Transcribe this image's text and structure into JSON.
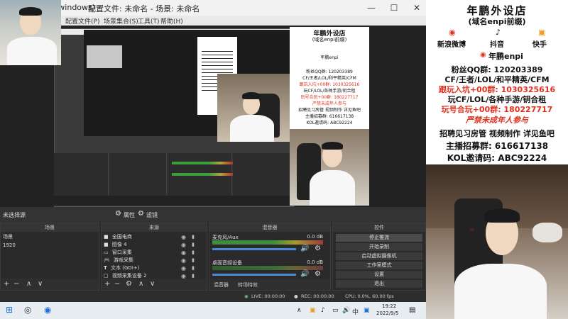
{
  "obs": {
    "window_title": "配置文件: 未命名 - 场景: 未命名",
    "title_prefix": "(windows)",
    "menu": [
      "配置文件(P)",
      "场景集合(S)",
      "工具(T)",
      "帮助(H)"
    ],
    "no_source_selected": "未选择源",
    "properties_label": "属性",
    "filters_label": "滤镜",
    "docks": {
      "scenes": {
        "title": "场景",
        "items": [
          "场景",
          "1920"
        ]
      },
      "sources": {
        "title": "来源",
        "items": [
          {
            "label": "全国电商",
            "icon": "■"
          },
          {
            "label": "图像 4",
            "icon": "■"
          },
          {
            "label": "窗口采集",
            "icon": "▭"
          },
          {
            "label": "游戏采集",
            "icon": "🎮"
          },
          {
            "label": "文本 (GDI+)",
            "icon": "T"
          },
          {
            "label": "视频采集设备 2",
            "icon": "▢"
          }
        ]
      },
      "mixer": {
        "title": "混音器",
        "channels": [
          {
            "name": "麦克风/Aux",
            "db": "0.0 dB"
          },
          {
            "name": "桌面音频设备",
            "db": "0.0 dB"
          }
        ],
        "tabs": [
          "混音器",
          "转场特效"
        ]
      },
      "controls": {
        "title": "控件",
        "buttons": [
          "停止推流",
          "开始录制",
          "启动虚拟摄像机",
          "工作室模式",
          "设置",
          "退出"
        ]
      }
    },
    "status": {
      "live": "LIVE: 00:00:00",
      "rec": "REC: 00:00:00",
      "cpu": "CPU: 0.0%, 60.00 fps"
    }
  },
  "taskbar": {
    "time": "19:22",
    "date": "2022/9/5",
    "ime": "中"
  },
  "ad_panel": {
    "title": "年鹏外设店",
    "subtitle": "(域名enpi前缀)",
    "socials": [
      {
        "name": "新浪微博",
        "icon": "weibo-icon",
        "glyph": "◉"
      },
      {
        "name": "抖音",
        "icon": "tiktok-icon",
        "glyph": "♪"
      },
      {
        "name": "快手",
        "icon": "kuaishou-icon",
        "glyph": "▣"
      }
    ],
    "brand": "年鹏enpi",
    "lines": [
      {
        "text": "粉丝QQ群: 120203389",
        "color": "#111111"
      },
      {
        "text": "CF/王者/LOL/和平精英/CFM",
        "color": "#111111"
      },
      {
        "text": "跟玩入坑+00群: 1030325616",
        "color": "#e0301e"
      },
      {
        "text": "玩CF/LOL/各种手游/钥合租",
        "color": "#111111"
      },
      {
        "text": "玩号合玩+00群: 180227717",
        "color": "#e0301e"
      },
      {
        "text": "严禁未成年人参与",
        "color": "#e0301e"
      },
      {
        "text": "招聘见习房管 视频制作 详见鱼吧",
        "color": "#111111"
      },
      {
        "text": "主播招募群: 616617138",
        "color": "#111111"
      },
      {
        "text": "KOL邀请码: ABC92224",
        "color": "#111111"
      }
    ],
    "colors": {
      "accent_red": "#e0301e",
      "text": "#111111"
    }
  }
}
